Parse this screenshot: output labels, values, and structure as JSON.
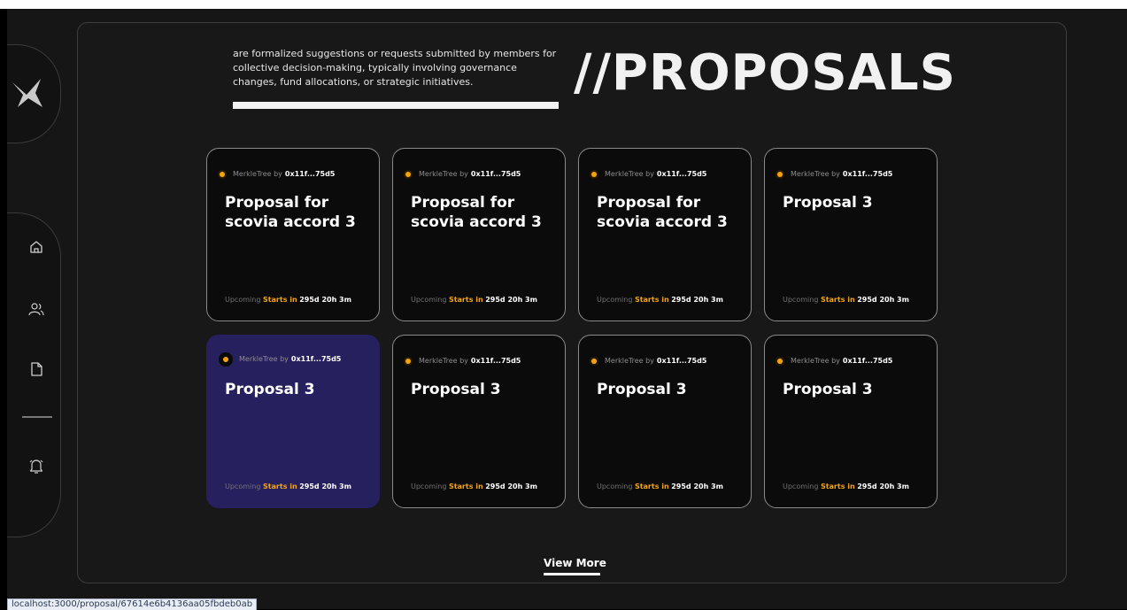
{
  "header": {
    "intro_text": "are formalized suggestions or requests submitted by members for collective decision-making, typically involving governance changes, fund allocations, or strategic initiatives.",
    "title": "//PROPOSALS"
  },
  "sidebar": {
    "logo_icon": "logo-icon",
    "items": [
      {
        "icon": "home-icon"
      },
      {
        "icon": "users-icon"
      },
      {
        "icon": "document-icon"
      },
      {
        "icon": "notification-bell-icon"
      }
    ]
  },
  "cards": [
    {
      "source": "MerkleTree by",
      "author": "0x11f...75d5",
      "title": "Proposal for scovia accord 3",
      "status": "Upcoming",
      "starts_label": "Starts in",
      "time": "295d 20h 3m"
    },
    {
      "source": "MerkleTree by",
      "author": "0x11f...75d5",
      "title": "Proposal for scovia accord 3",
      "status": "Upcoming",
      "starts_label": "Starts in",
      "time": "295d 20h 3m"
    },
    {
      "source": "MerkleTree by",
      "author": "0x11f...75d5",
      "title": "Proposal for scovia accord 3",
      "status": "Upcoming",
      "starts_label": "Starts in",
      "time": "295d 20h 3m"
    },
    {
      "source": "MerkleTree by",
      "author": "0x11f...75d5",
      "title": "Proposal 3",
      "status": "Upcoming",
      "starts_label": "Starts in",
      "time": "295d 20h 3m"
    },
    {
      "source": "MerkleTree by",
      "author": "0x11f...75d5",
      "title": "Proposal 3",
      "status": "Upcoming",
      "starts_label": "Starts in",
      "time": "295d 20h 3m"
    },
    {
      "source": "MerkleTree by",
      "author": "0x11f...75d5",
      "title": "Proposal 3",
      "status": "Upcoming",
      "starts_label": "Starts in",
      "time": "295d 20h 3m"
    },
    {
      "source": "MerkleTree by",
      "author": "0x11f...75d5",
      "title": "Proposal 3",
      "status": "Upcoming",
      "starts_label": "Starts in",
      "time": "295d 20h 3m"
    },
    {
      "source": "MerkleTree by",
      "author": "0x11f...75d5",
      "title": "Proposal 3",
      "status": "Upcoming",
      "starts_label": "Starts in",
      "time": "295d 20h 3m"
    }
  ],
  "view_more_label": "View More",
  "status_bar_url": "localhost:3000/proposal/67614e6b4136aa05fbdeb0ab",
  "colors": {
    "accent_orange": "#f3a40f",
    "active_card": "#27205f",
    "background": "#161616"
  }
}
